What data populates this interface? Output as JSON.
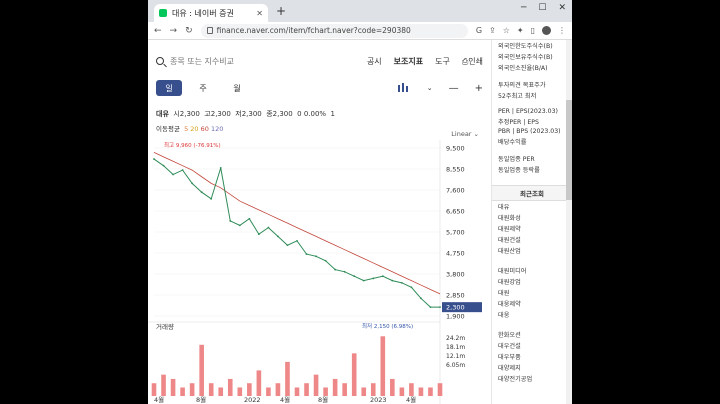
{
  "browser": {
    "tab_title": "대유 : 네이버 증권",
    "url": "finance.naver.com/item/fchart.naver?code=290380"
  },
  "toolbar": {
    "search_placeholder": "종목 또는 지수비교",
    "links": [
      "공시",
      "보조지표",
      "도구",
      "인쇄"
    ]
  },
  "periods": [
    "일",
    "주",
    "월"
  ],
  "info": {
    "name": "대유",
    "open_label": "시",
    "open": "2,300",
    "high_label": "고",
    "high": "2,300",
    "low_label": "저",
    "low": "2,300",
    "close_label": "종",
    "close": "2,300",
    "change": "0 0.00%",
    "volume": "1"
  },
  "ma": {
    "label": "이동평균",
    "values": [
      "5",
      "20",
      "60",
      "120"
    ]
  },
  "scale_label": "Linear",
  "chart_data": {
    "type": "line",
    "y_ticks": [
      "9,500",
      "8,550",
      "7,600",
      "6,650",
      "5,700",
      "4,750",
      "3,800",
      "2,850",
      "1,900"
    ],
    "x_ticks": [
      "4월",
      "8월",
      "2022",
      "4월",
      "8월",
      "2023",
      "4월"
    ],
    "ylim": [
      1900,
      9500
    ],
    "high_label": "최고 9,960 (-76.91%)",
    "low_label": "최저 2,150 (6.98%)",
    "current_label": "2,300",
    "x": [
      0,
      1,
      2,
      3,
      4,
      5,
      6,
      7,
      8,
      9,
      10,
      11,
      12,
      13,
      14,
      15,
      16,
      17,
      18,
      19,
      20,
      21,
      22,
      23,
      24,
      25,
      26,
      27,
      28,
      29,
      30
    ],
    "close": [
      9000,
      8700,
      8300,
      8500,
      7900,
      7500,
      7200,
      8600,
      6200,
      6000,
      6300,
      5600,
      5900,
      5500,
      5100,
      5300,
      4700,
      4600,
      4400,
      4000,
      3900,
      3700,
      3500,
      3600,
      3700,
      3500,
      3400,
      3200,
      2700,
      2300,
      2300
    ],
    "ma_long": [
      9300,
      9100,
      8900,
      8700,
      8500,
      8200,
      7900,
      7700,
      7400,
      7100,
      6900,
      6700,
      6500,
      6300,
      6100,
      5900,
      5700,
      5500,
      5300,
      5100,
      4900,
      4700,
      4500,
      4300,
      4100,
      3900,
      3700,
      3500,
      3300,
      3100,
      2900
    ],
    "volume_ticks": [
      "24.2m",
      "18.1m",
      "12.1m",
      "6.05m"
    ],
    "volume_title": "거래량",
    "volume": [
      3,
      5,
      4,
      2,
      3,
      12,
      3,
      2,
      4,
      2,
      3,
      6,
      2,
      3,
      8,
      2,
      3,
      5,
      2,
      4,
      3,
      10,
      2,
      3,
      14,
      4,
      2,
      3,
      2,
      2,
      3
    ]
  },
  "side": {
    "top_items": [
      "외국인한도주식수(B)",
      "외국인보유주식수(B)",
      "외국인소진율(B/A)"
    ],
    "mid_items": [
      "투자의견 목표주가",
      "52주최고 최저"
    ],
    "per_items": [
      "PER | EPS(2023.03)",
      "추정PER | EPS",
      "PBR | BPS (2023.03)",
      "배당수익률"
    ],
    "sector_items": [
      "동일업종 PER",
      "동일업종 등락률"
    ],
    "recent_head": "최근조회",
    "recent_items": [
      "대유",
      "대원화성",
      "대원제약",
      "대원건설",
      "대원산업",
      "",
      "대원미디어",
      "대원강업",
      "대원",
      "대웅제약",
      "대웅",
      "",
      "한화오션",
      "대우건설",
      "대우부품",
      "대양제지",
      "대양전기공업"
    ]
  }
}
